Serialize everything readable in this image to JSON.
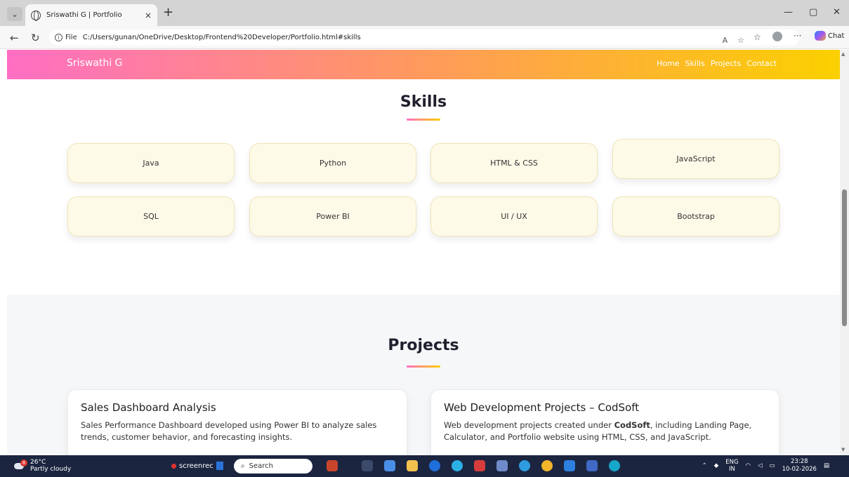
{
  "browser": {
    "tab_title": "Sriswathi G | Portfolio",
    "tab_close": "×",
    "new_tab": "+",
    "address_prefix": "File",
    "url": "C:/Users/gunan/OneDrive/Desktop/Frontend%20Developer/Portfolio.html#skills",
    "chat_label": "Chat"
  },
  "site": {
    "brand": "Sriswathi G",
    "nav": {
      "home": "Home",
      "skills": "Skills",
      "projects": "Projects",
      "contact": "Contact"
    }
  },
  "skills": {
    "title": "Skills",
    "items": [
      "Java",
      "Python",
      "HTML & CSS",
      "JavaScript",
      "SQL",
      "Power BI",
      "UI / UX",
      "Bootstrap"
    ]
  },
  "projects": {
    "title": "Projects",
    "cards": [
      {
        "title": "Sales Dashboard Analysis",
        "description": "Sales Performance Dashboard developed using Power BI to analyze sales trends, customer behavior, and forecasting insights."
      },
      {
        "title": "Web Development Projects – CodSoft",
        "desc_before": "Web development projects created under ",
        "desc_bold": "CodSoft",
        "desc_after": ", including Landing Page, Calculator, and Portfolio website using HTML, CSS, and JavaScript."
      }
    ]
  },
  "taskbar": {
    "weather_temp": "26°C",
    "weather_desc": "Partly cloudy",
    "weather_badge": "8",
    "screenrec_label": "screenrec",
    "search_label": "Search",
    "lang_top": "ENG",
    "lang_bottom": "IN",
    "time": "23:28",
    "date": "10-02-2026"
  },
  "colors": {
    "navbar_gradient_start": "#ff6ec4",
    "navbar_gradient_mid": "#ff9a5c",
    "navbar_gradient_end": "#fbd000",
    "skill_card_bg": "#fefae8",
    "projects_bg": "#f6f7f9",
    "taskbar_bg": "#1b2540"
  },
  "icons": {
    "tab_menu": "chevron-down-icon",
    "tab_favicon": "globe-icon",
    "back": "back-arrow-icon",
    "refresh": "refresh-icon",
    "info": "info-icon",
    "read_aloud": "read-aloud-icon",
    "favorite": "star-icon",
    "collections": "favorites-icon",
    "profile": "profile-icon",
    "more": "more-icon",
    "copilot": "copilot-icon"
  }
}
